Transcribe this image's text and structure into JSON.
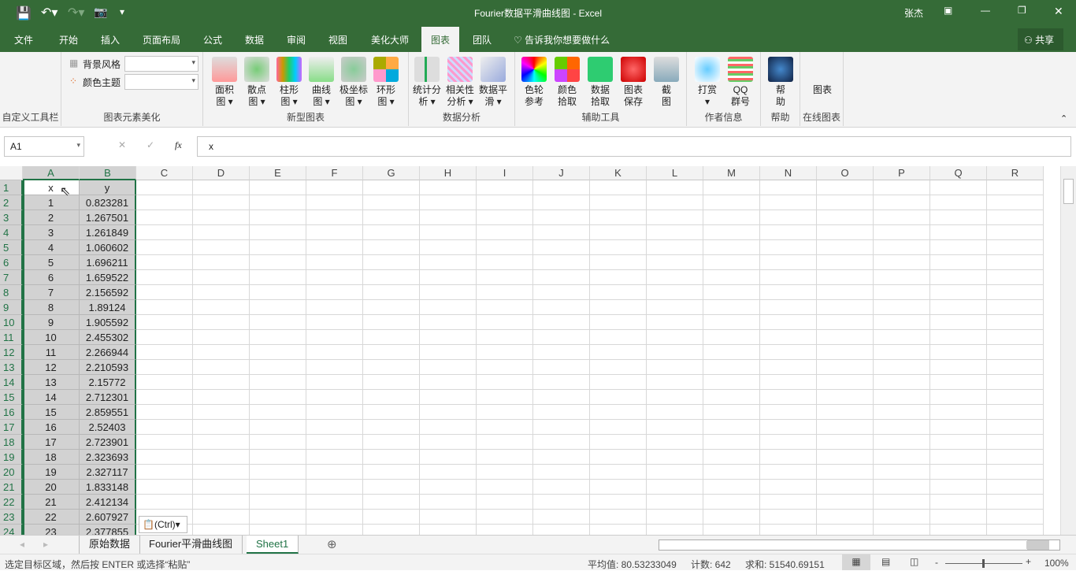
{
  "window": {
    "title": "Fourier数据平滑曲线图 - Excel",
    "user": "张杰",
    "share": "共享"
  },
  "tabs": [
    "文件",
    "开始",
    "插入",
    "页面布局",
    "公式",
    "数据",
    "审阅",
    "视图",
    "美化大师",
    "图表",
    "团队"
  ],
  "active_tab": "图表",
  "tell_me": "告诉我你想要做什么",
  "ribbon": {
    "groups": [
      "自定义工具栏",
      "图表元素美化",
      "新型图表",
      "数据分析",
      "辅助工具",
      "作者信息",
      "帮助",
      "在线图表"
    ],
    "bg_style_label": "背景风格",
    "color_theme_label": "颜色主题",
    "chart_buttons": [
      {
        "l1": "面积",
        "l2": "图 ▾"
      },
      {
        "l1": "散点",
        "l2": "图 ▾"
      },
      {
        "l1": "柱形",
        "l2": "图 ▾"
      },
      {
        "l1": "曲线",
        "l2": "图 ▾"
      },
      {
        "l1": "极坐标",
        "l2": "图 ▾"
      },
      {
        "l1": "环形",
        "l2": "图 ▾"
      }
    ],
    "analysis_buttons": [
      {
        "l1": "统计分",
        "l2": "析 ▾"
      },
      {
        "l1": "相关性",
        "l2": "分析 ▾"
      },
      {
        "l1": "数据平",
        "l2": "滑 ▾"
      }
    ],
    "tool_buttons": [
      {
        "l1": "色轮",
        "l2": "参考"
      },
      {
        "l1": "颜色",
        "l2": "拾取"
      },
      {
        "l1": "数据",
        "l2": "拾取"
      },
      {
        "l1": "图表",
        "l2": "保存"
      },
      {
        "l1": "截",
        "l2": "图"
      }
    ],
    "author_buttons": [
      {
        "l1": "打赏",
        "l2": "▾"
      },
      {
        "l1": "QQ",
        "l2": "群号"
      }
    ],
    "help_button": {
      "l1": "帮",
      "l2": "助"
    },
    "online_button": {
      "l1": "图表",
      "l2": ""
    }
  },
  "formula_bar": {
    "name_box": "A1",
    "fx": "fx",
    "value": "x"
  },
  "columns": [
    "A",
    "B",
    "C",
    "D",
    "E",
    "F",
    "G",
    "H",
    "I",
    "J",
    "K",
    "L",
    "M",
    "N",
    "O",
    "P",
    "Q",
    "R"
  ],
  "rows": [
    [
      "x",
      "y"
    ],
    [
      "1",
      "0.823281"
    ],
    [
      "2",
      "1.267501"
    ],
    [
      "3",
      "1.261849"
    ],
    [
      "4",
      "1.060602"
    ],
    [
      "5",
      "1.696211"
    ],
    [
      "6",
      "1.659522"
    ],
    [
      "7",
      "2.156592"
    ],
    [
      "8",
      "1.89124"
    ],
    [
      "9",
      "1.905592"
    ],
    [
      "10",
      "2.455302"
    ],
    [
      "11",
      "2.266944"
    ],
    [
      "12",
      "2.210593"
    ],
    [
      "13",
      "2.15772"
    ],
    [
      "14",
      "2.712301"
    ],
    [
      "15",
      "2.859551"
    ],
    [
      "16",
      "2.52403"
    ],
    [
      "17",
      "2.723901"
    ],
    [
      "18",
      "2.323693"
    ],
    [
      "19",
      "2.327117"
    ],
    [
      "20",
      "1.833148"
    ],
    [
      "21",
      "2.412134"
    ],
    [
      "22",
      "2.607927"
    ],
    [
      "23",
      "2.377855"
    ]
  ],
  "paste_options": "(Ctrl)",
  "sheets": [
    "原始数据",
    "Fourier平滑曲线图",
    "Sheet1"
  ],
  "active_sheet": "Sheet1",
  "status": {
    "message": "选定目标区域，然后按 ENTER 或选择“粘贴”",
    "average": "平均值: 80.53233049",
    "count": "计数: 642",
    "sum": "求和: 51540.69151",
    "zoom": "100%"
  }
}
